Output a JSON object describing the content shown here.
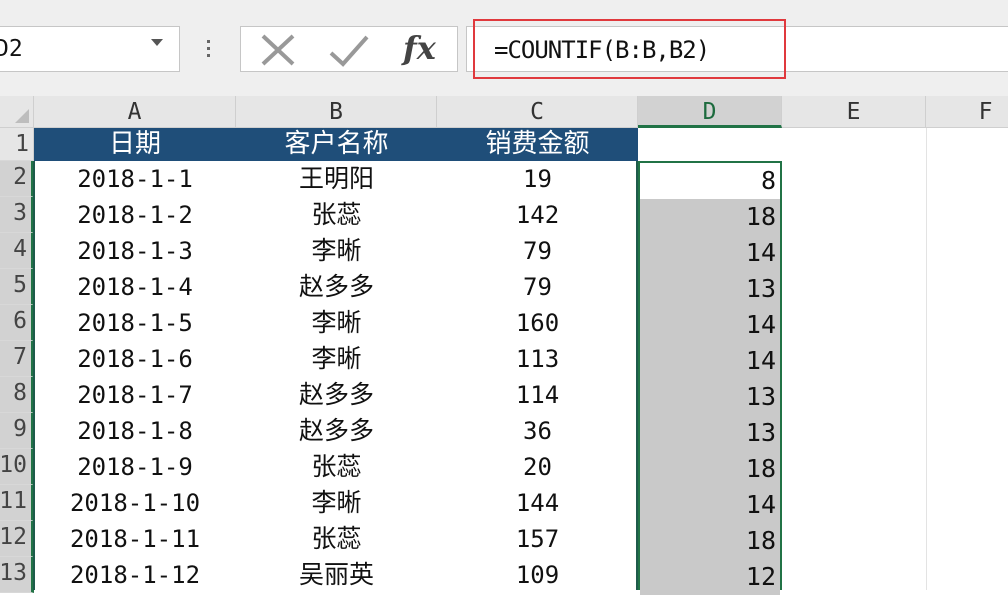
{
  "name_box": {
    "value": "D2"
  },
  "formula_bar": {
    "cancel_icon": "x-icon",
    "enter_icon": "check-icon",
    "fx_label": "fx",
    "formula": "=COUNTIF(B:B,B2)"
  },
  "columns": [
    "A",
    "B",
    "C",
    "D",
    "E",
    "F"
  ],
  "header_row": {
    "row_number": "1",
    "cells": [
      "日期",
      "客户名称",
      "销费金额"
    ]
  },
  "rows": [
    {
      "num": "2",
      "date": "2018-1-1",
      "customer": "王明阳",
      "amount": "19",
      "count": "8"
    },
    {
      "num": "3",
      "date": "2018-1-2",
      "customer": "张蕊",
      "amount": "142",
      "count": "18"
    },
    {
      "num": "4",
      "date": "2018-1-3",
      "customer": "李晰",
      "amount": "79",
      "count": "14"
    },
    {
      "num": "5",
      "date": "2018-1-4",
      "customer": "赵多多",
      "amount": "79",
      "count": "13"
    },
    {
      "num": "6",
      "date": "2018-1-5",
      "customer": "李晰",
      "amount": "160",
      "count": "14"
    },
    {
      "num": "7",
      "date": "2018-1-6",
      "customer": "李晰",
      "amount": "113",
      "count": "14"
    },
    {
      "num": "8",
      "date": "2018-1-7",
      "customer": "赵多多",
      "amount": "114",
      "count": "13"
    },
    {
      "num": "9",
      "date": "2018-1-8",
      "customer": "赵多多",
      "amount": "36",
      "count": "13"
    },
    {
      "num": "10",
      "date": "2018-1-9",
      "customer": "张蕊",
      "amount": "20",
      "count": "18"
    },
    {
      "num": "11",
      "date": "2018-1-10",
      "customer": "李晰",
      "amount": "144",
      "count": "14"
    },
    {
      "num": "12",
      "date": "2018-1-11",
      "customer": "张蕊",
      "amount": "157",
      "count": "18"
    },
    {
      "num": "13",
      "date": "2018-1-12",
      "customer": "吴丽英",
      "amount": "109",
      "count": "12"
    }
  ],
  "colors": {
    "header_fill": "#1f4e79",
    "selection": "#217346",
    "highlight_box": "#e0393d",
    "fill_shade": "#c9c9c9"
  }
}
